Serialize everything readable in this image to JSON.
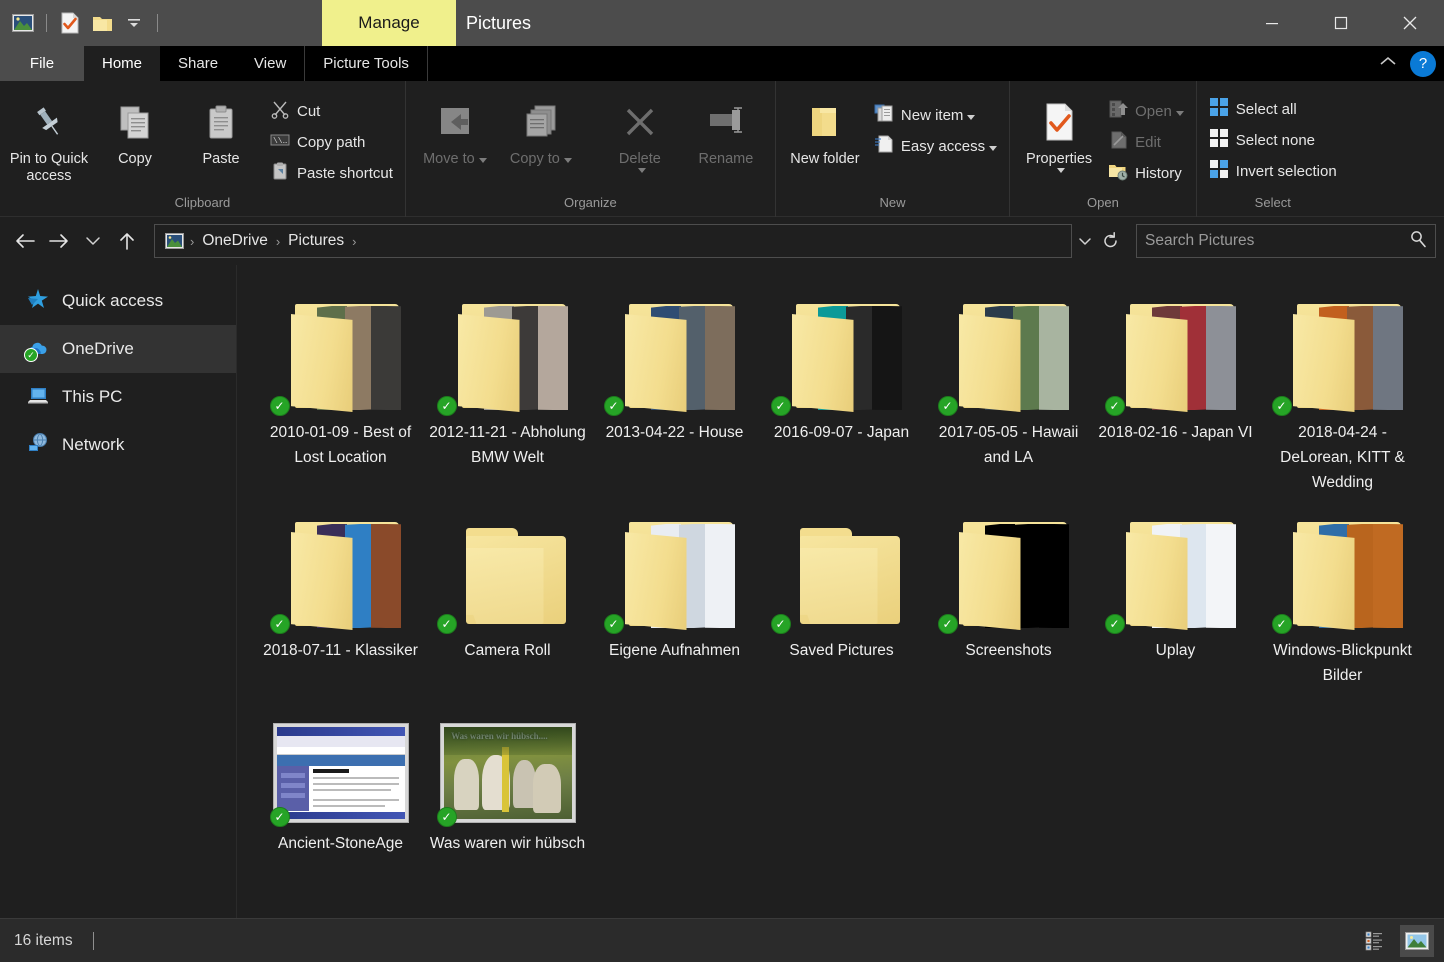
{
  "window": {
    "title": "Pictures",
    "contextual_tab_group": "Manage",
    "quick_access_icons": [
      "picture-icon",
      "properties-check-icon",
      "new-folder-icon",
      "customize-qat-chevron-icon"
    ],
    "controls": {
      "minimize": "minimize-icon",
      "maximize": "maximize-icon",
      "close": "close-icon"
    }
  },
  "ribbon": {
    "tabs": [
      {
        "label": "File",
        "state": "file"
      },
      {
        "label": "Home",
        "state": "active"
      },
      {
        "label": "Share",
        "state": "normal"
      },
      {
        "label": "View",
        "state": "normal"
      },
      {
        "label": "Picture Tools",
        "state": "contextual"
      }
    ],
    "collapse_label": "^",
    "help_label": "?",
    "groups": [
      {
        "name": "Clipboard",
        "big_buttons": [
          {
            "label": "Pin to Quick access",
            "icon": "pin-icon",
            "disabled": false
          },
          {
            "label": "Copy",
            "icon": "copy-icon",
            "disabled": false
          },
          {
            "label": "Paste",
            "icon": "paste-icon",
            "disabled": false
          }
        ],
        "small_buttons": [
          {
            "label": "Cut",
            "icon": "scissors-icon"
          },
          {
            "label": "Copy path",
            "icon": "copy-path-icon"
          },
          {
            "label": "Paste shortcut",
            "icon": "paste-shortcut-icon"
          }
        ]
      },
      {
        "name": "Organize",
        "big_buttons": [
          {
            "label": "Move to",
            "icon": "move-to-icon",
            "has_caret": true,
            "disabled": true
          },
          {
            "label": "Copy to",
            "icon": "copy-to-icon",
            "has_caret": true,
            "disabled": true
          },
          {
            "label": "Delete",
            "icon": "delete-x-icon",
            "has_caret": true,
            "disabled": true
          },
          {
            "label": "Rename",
            "icon": "rename-icon",
            "disabled": true
          }
        ]
      },
      {
        "name": "New",
        "big_buttons": [
          {
            "label": "New folder",
            "icon": "new-folder-icon",
            "disabled": false
          }
        ],
        "small_buttons": [
          {
            "label": "New item",
            "icon": "new-item-icon",
            "has_caret": true
          },
          {
            "label": "Easy access",
            "icon": "easy-access-icon",
            "has_caret": true
          }
        ]
      },
      {
        "name": "Open",
        "big_buttons": [
          {
            "label": "Properties",
            "icon": "properties-icon",
            "has_caret": true,
            "disabled": false
          }
        ],
        "small_buttons": [
          {
            "label": "Open",
            "icon": "open-icon",
            "has_caret": true,
            "disabled": true
          },
          {
            "label": "Edit",
            "icon": "edit-icon",
            "disabled": true
          },
          {
            "label": "History",
            "icon": "history-icon"
          }
        ]
      },
      {
        "name": "Select",
        "small_buttons": [
          {
            "label": "Select all",
            "icon": "select-all-icon"
          },
          {
            "label": "Select none",
            "icon": "select-none-icon"
          },
          {
            "label": "Invert selection",
            "icon": "invert-selection-icon"
          }
        ]
      }
    ]
  },
  "navbar": {
    "back": "back-arrow-icon",
    "forward": "forward-arrow-icon",
    "recent": "recent-locations-chevron-icon",
    "up": "up-arrow-icon",
    "breadcrumb_icon": "pictures-library-icon",
    "breadcrumbs": [
      "OneDrive",
      "Pictures"
    ],
    "separator": "›",
    "dropdown_icon": "address-dropdown-icon",
    "refresh_icon": "refresh-icon",
    "search": {
      "placeholder": "Search Pictures",
      "value": "",
      "icon": "search-icon"
    }
  },
  "sidebar": {
    "items": [
      {
        "label": "Quick access",
        "icon": "quick-access-star-icon",
        "selected": false
      },
      {
        "label": "OneDrive",
        "icon": "onedrive-cloud-icon",
        "selected": true
      },
      {
        "label": "This PC",
        "icon": "this-pc-icon",
        "selected": false
      },
      {
        "label": "Network",
        "icon": "network-icon",
        "selected": false
      }
    ]
  },
  "content": {
    "items": [
      {
        "name": "2010-01-09 - Best of Lost Location",
        "type": "folder",
        "sync": "synced",
        "thumbs": [
          "#5e6f4a",
          "#8d7a63",
          "#3b3a38"
        ]
      },
      {
        "name": "2012-11-21 - Abholung BMW Welt",
        "type": "folder",
        "sync": "synced",
        "thumbs": [
          "#9d9a93",
          "#3d3a39",
          "#b4a79c"
        ]
      },
      {
        "name": "2013-04-22 - House",
        "type": "folder",
        "sync": "synced",
        "thumbs": [
          "#2f4d73",
          "#53606b",
          "#7d6d5c"
        ]
      },
      {
        "name": "2016-09-07 - Japan",
        "type": "folder",
        "sync": "synced",
        "thumbs": [
          "#0c9a98",
          "#2a2a2a",
          "#151515"
        ]
      },
      {
        "name": "2017-05-05 - Hawaii and LA",
        "type": "folder",
        "sync": "synced",
        "thumbs": [
          "#2b3b4a",
          "#5d7a4e",
          "#a8b4a0"
        ]
      },
      {
        "name": "2018-02-16 - Japan VI",
        "type": "folder",
        "sync": "synced",
        "thumbs": [
          "#6e3a3a",
          "#a03038",
          "#8d9097"
        ]
      },
      {
        "name": "2018-04-24 - DeLorean, KITT & Wedding",
        "type": "folder",
        "sync": "synced",
        "thumbs": [
          "#c2601e",
          "#8a5a3a",
          "#6f7681"
        ]
      },
      {
        "name": "2018-07-11 - Klassiker",
        "type": "folder",
        "sync": "synced",
        "thumbs": [
          "#3a2f58",
          "#2f7fc4",
          "#8a4a2a"
        ]
      },
      {
        "name": "Camera Roll",
        "type": "folder-empty",
        "sync": "synced",
        "thumbs": []
      },
      {
        "name": "Eigene Aufnahmen",
        "type": "folder",
        "sync": "synced",
        "thumbs": [
          "#e9edf2",
          "#cfd7e0",
          "#eef1f5"
        ]
      },
      {
        "name": "Saved Pictures",
        "type": "folder-empty",
        "sync": "synced",
        "thumbs": []
      },
      {
        "name": "Screenshots",
        "type": "folder",
        "sync": "synced",
        "thumbs": [
          "#000000",
          "#000000",
          "#000000"
        ]
      },
      {
        "name": "Uplay",
        "type": "folder",
        "sync": "synced",
        "thumbs": [
          "#f0f3f7",
          "#dde6ef",
          "#f3f5f8"
        ]
      },
      {
        "name": "Windows-Blickpunkt Bilder",
        "type": "folder",
        "sync": "synced",
        "thumbs": [
          "#2f6ea8",
          "#b9651e",
          "#c06a22"
        ]
      },
      {
        "name": "Ancient-StoneAge",
        "type": "picture",
        "sync": "synced",
        "thumbs": [
          "#ffffff"
        ]
      },
      {
        "name": "Was waren wir hübsch",
        "type": "picture",
        "sync": "synced",
        "thumbs": [
          "#5b7339"
        ]
      }
    ]
  },
  "statusbar": {
    "item_count": "16 items",
    "views": [
      {
        "name": "details-view-button",
        "active": false
      },
      {
        "name": "large-icons-view-button",
        "active": true
      }
    ]
  },
  "colors": {
    "window_chrome": "#4c4c4c",
    "ribbon_bg": "#1f1f1f",
    "contextual_tab": "#f0f08c",
    "accent_blue": "#0a7ad6",
    "sync_green": "#26a426",
    "selection": "#333333"
  }
}
